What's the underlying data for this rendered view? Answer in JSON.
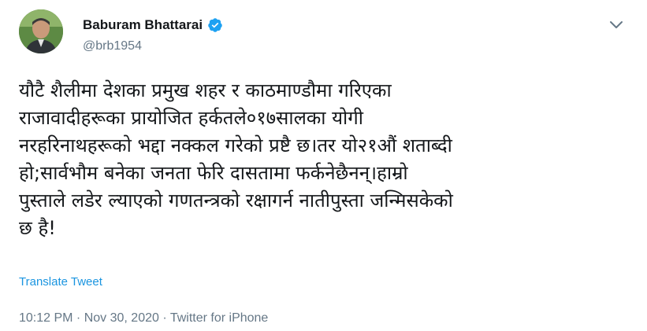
{
  "author": {
    "display_name": "Baburam Bhattarai",
    "handle": "@brb1954",
    "verified": true
  },
  "tweet": {
    "text": "यौटै शैलीमा देशका प्रमुख शहर र काठमाण्डौमा गरिएका\nराजावादीहरूका प्रायोजित हर्कतले०१७सालका योगी\nनरहरिनाथहरूको भद्दा नक्कल गरेको प्रष्टै छ।तर यो२१औं शताब्दी\nहो;सार्वभौम बनेका जनता फेरि दासतामा फर्कनेछैनन्।हाम्रो\nपुस्ताले लडेर ल्याएको गणतन्त्रको रक्षागर्न नातीपुस्ता जन्मिसकेको\nछ है!",
    "translate_label": "Translate Tweet",
    "time": "10:12 PM",
    "separator_1": " · ",
    "date": "Nov 30, 2020",
    "separator_2": " · ",
    "source": "Twitter for iPhone"
  },
  "colors": {
    "link": "#1b95e0",
    "secondary_text": "#657786",
    "verified_badge": "#1da1f2"
  },
  "icons": [
    "verified-badge-icon",
    "chevron-down-icon"
  ]
}
